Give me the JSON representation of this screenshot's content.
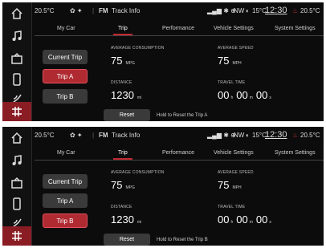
{
  "status": {
    "temp_left": "20.5°C",
    "source": "FM",
    "track": "Track Info",
    "heading": "NW",
    "outside_temp": "15°C",
    "time": "12:30",
    "temp_right": "20.5°C"
  },
  "tabs": [
    "My Car",
    "Trip",
    "Performance",
    "Vehicle Settings",
    "System Settings"
  ],
  "trip_buttons": [
    "Current Trip",
    "Trip A",
    "Trip B"
  ],
  "metrics": {
    "avg_consumption_label": "AVERAGE CONSUMPTION",
    "avg_consumption_value": "75",
    "avg_consumption_unit": "MPG",
    "avg_speed_label": "AVERAGE SPEED",
    "avg_speed_value": "75",
    "avg_speed_unit": "MPH",
    "distance_label": "DISTANCE",
    "distance_value": "1230",
    "distance_unit": "mi",
    "travel_time_label": "TRAVEL TIME",
    "tt_hours": "00",
    "tt_h_unit": "h",
    "tt_minutes": "00",
    "tt_m_unit": "m",
    "tt_seconds": "00",
    "tt_s_unit": "s"
  },
  "reset_label": "Reset",
  "panel1": {
    "hint": "Hold to Reset the Trip A",
    "active_button": "Trip A"
  },
  "panel2": {
    "hint": "Hold to Reset the Trip B",
    "active_button": "Trip B"
  },
  "colors": {
    "accent": "#b02a32",
    "background": "#0c0c0c"
  }
}
